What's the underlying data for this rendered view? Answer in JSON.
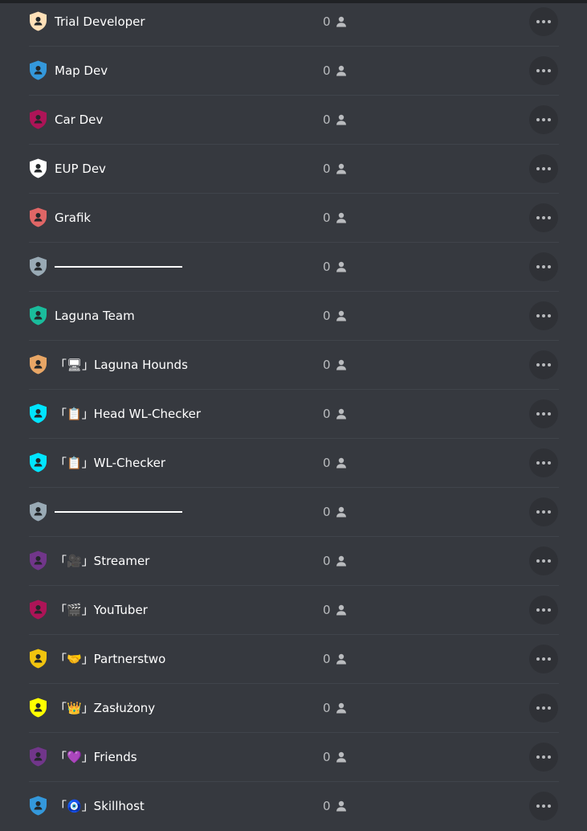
{
  "roles": [
    {
      "name": "Trial Developer",
      "color": "#ffe0b8",
      "count": "0",
      "divider": false
    },
    {
      "name": "Map Dev",
      "color": "#3498db",
      "count": "0",
      "divider": false
    },
    {
      "name": "Car Dev",
      "color": "#ad1457",
      "count": "0",
      "divider": false
    },
    {
      "name": "EUP Dev",
      "color": "#ffffff",
      "count": "0",
      "divider": false
    },
    {
      "name": "Grafik",
      "color": "#e06666",
      "count": "0",
      "divider": false
    },
    {
      "name": "",
      "color": "#99aab5",
      "count": "0",
      "divider": true
    },
    {
      "name": "Laguna Team",
      "color": "#1abc9c",
      "count": "0",
      "divider": false
    },
    {
      "name": "「🖥」Laguna Hounds",
      "color": "#e8a665",
      "count": "0",
      "divider": false
    },
    {
      "name": "「📋」Head WL-Checker",
      "color": "#00e5ff",
      "count": "0",
      "divider": false
    },
    {
      "name": "「📋」WL-Checker",
      "color": "#00e5ff",
      "count": "0",
      "divider": false
    },
    {
      "name": "",
      "color": "#99aab5",
      "count": "0",
      "divider": true
    },
    {
      "name": "「🎥」Streamer",
      "color": "#71368a",
      "count": "0",
      "divider": false
    },
    {
      "name": "「🎬」YouTuber",
      "color": "#ad1457",
      "count": "0",
      "divider": false
    },
    {
      "name": "「🤝」Partnerstwo",
      "color": "#f1c40f",
      "count": "0",
      "divider": false
    },
    {
      "name": "「👑」Zasłużony",
      "color": "#ffff00",
      "count": "0",
      "divider": false
    },
    {
      "name": "「💜」Friends",
      "color": "#71368a",
      "count": "0",
      "divider": false
    },
    {
      "name": "「🧿」Skillhost",
      "color": "#3498db",
      "count": "0",
      "divider": false
    }
  ],
  "icons": {
    "role": "shield-person-icon",
    "members": "person-icon",
    "more": "more-options-icon"
  }
}
